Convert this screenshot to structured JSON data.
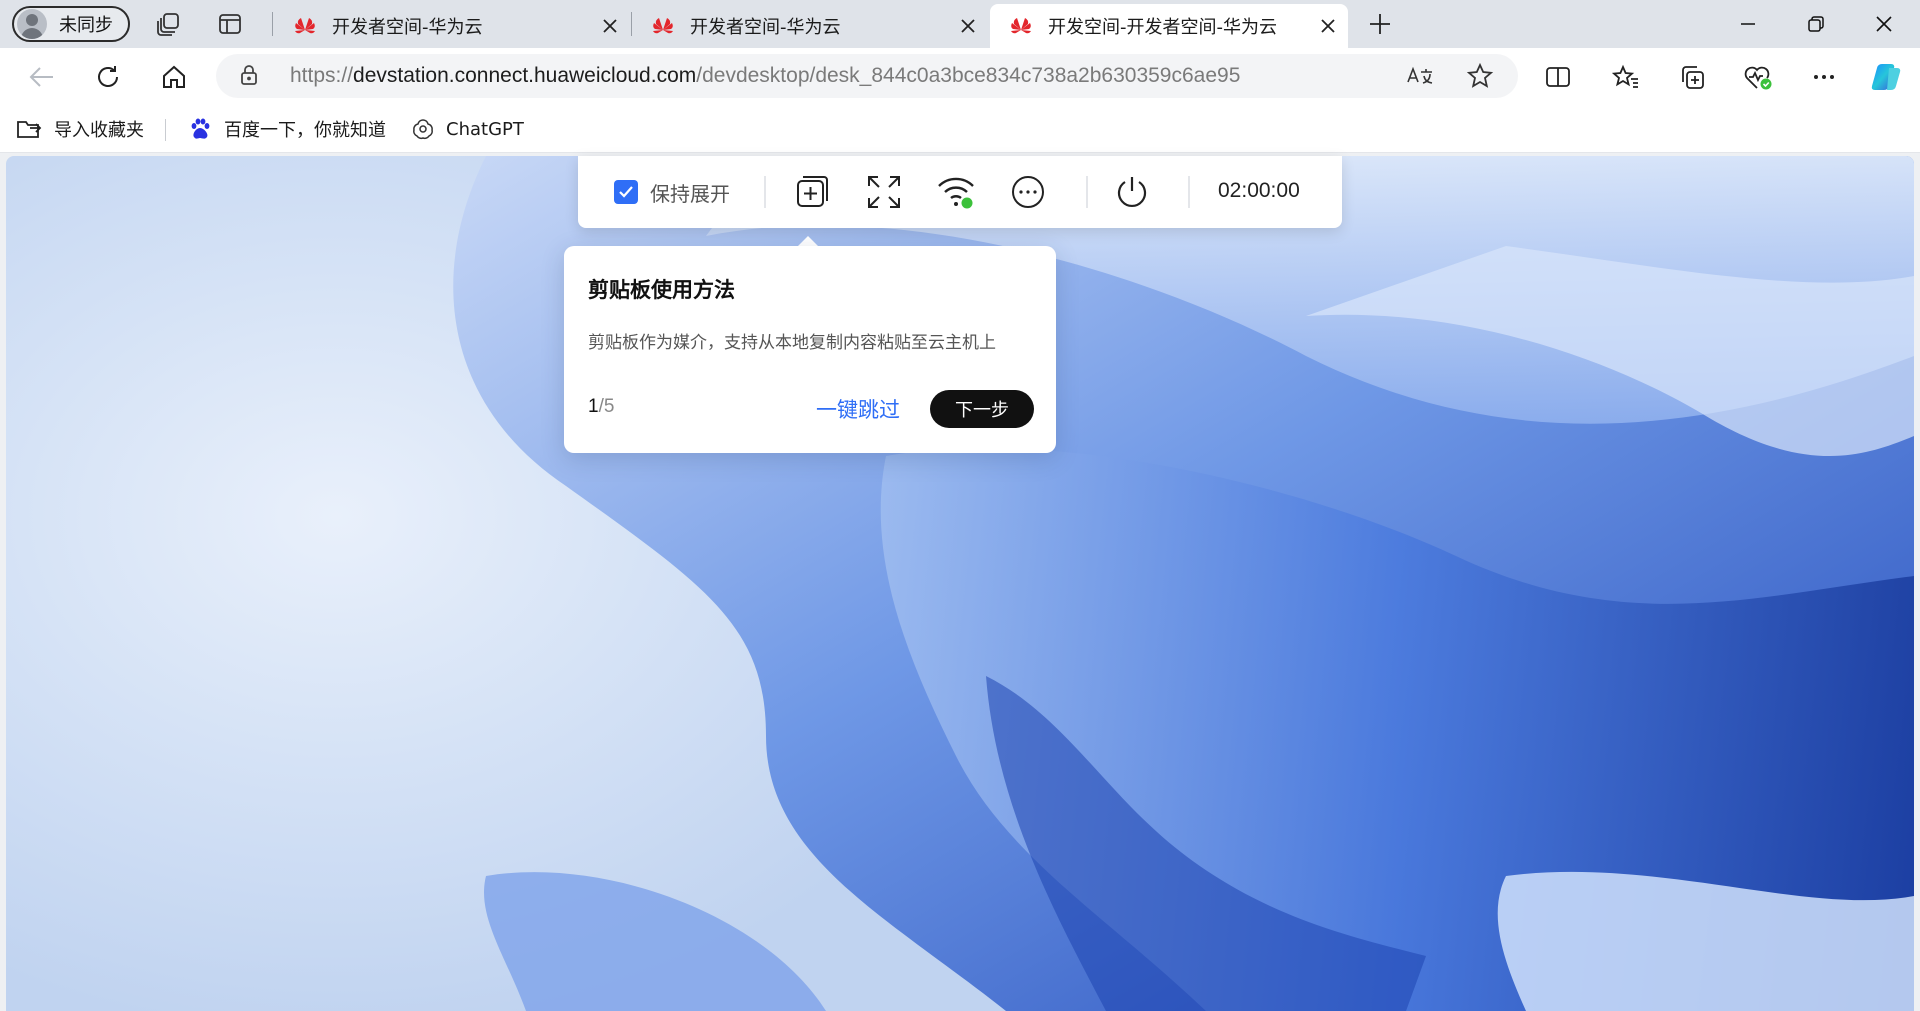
{
  "browser": {
    "profile_label": "未同步",
    "tabs": [
      {
        "title": "开发者空间-华为云",
        "active": false
      },
      {
        "title": "开发者空间-华为云",
        "active": false
      },
      {
        "title": "开发空间-开发者空间-华为云",
        "active": true
      }
    ],
    "address": {
      "scheme": "https://",
      "host": "devstation.connect.huaweicloud.com",
      "path": "/devdesktop/desk_844c0a3bce834c738a2b630359c6ae95"
    },
    "favorites": [
      {
        "label": "导入收藏夹",
        "icon": "import-favorites-icon"
      },
      {
        "label": "百度一下，你就知道",
        "icon": "baidu-paw-icon"
      },
      {
        "label": "ChatGPT",
        "icon": "chatgpt-icon"
      }
    ]
  },
  "desk_toolbar": {
    "keep_expanded_label": "保持展开",
    "keep_expanded_checked": true,
    "timer": "02:00:00",
    "icons": [
      "clipboard-add-icon",
      "fullscreen-icon",
      "wifi-icon",
      "more-icon",
      "power-icon"
    ]
  },
  "guide": {
    "title": "剪贴板使用方法",
    "description": "剪贴板作为媒介，支持从本地复制内容粘贴至云主机上",
    "step_current": "1",
    "step_separator": "/",
    "step_total": "5",
    "skip_label": "一键跳过",
    "next_label": "下一步"
  },
  "colors": {
    "accent": "#2f6ef6",
    "wifi_status": "#3cc13b",
    "brand_red": "#e3262c"
  }
}
